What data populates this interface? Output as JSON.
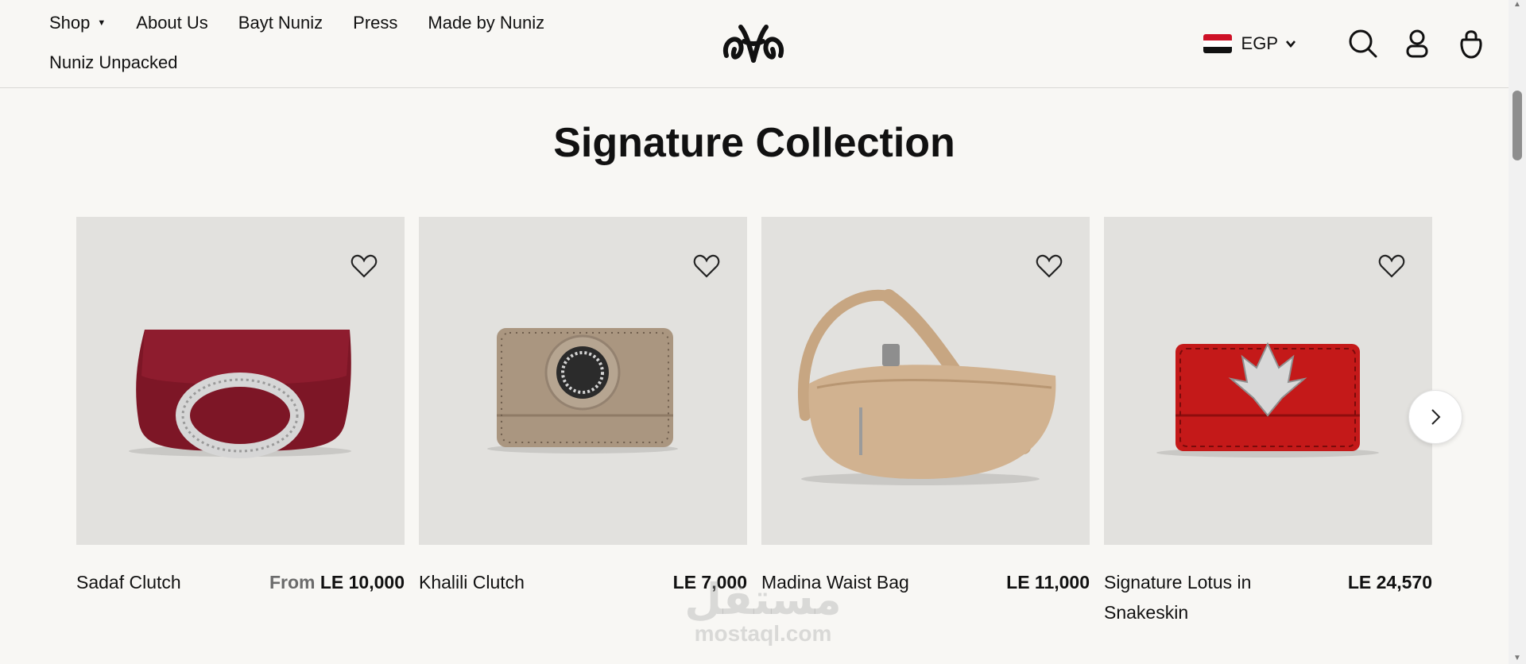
{
  "nav": {
    "items": [
      {
        "label": "Shop",
        "caret": "▼"
      },
      {
        "label": "About Us"
      },
      {
        "label": "Bayt Nuniz"
      },
      {
        "label": "Press"
      },
      {
        "label": "Made by Nuniz"
      },
      {
        "label": "Nuniz Unpacked"
      }
    ]
  },
  "header": {
    "currency": "EGP",
    "flag_colors": [
      "#ce1126",
      "#ffffff",
      "#000000"
    ],
    "icons": [
      "logo-icon",
      "search-icon",
      "account-icon",
      "bag-icon"
    ]
  },
  "collection": {
    "title": "Signature Collection",
    "products": [
      {
        "name": "Sadaf Clutch",
        "price_prefix": "From",
        "price": "LE 10,000",
        "color": "#7d1626"
      },
      {
        "name": "Khalili Clutch",
        "price_prefix": "",
        "price": "LE 7,000",
        "color": "#aa9680"
      },
      {
        "name": "Madina Waist Bag",
        "price_prefix": "",
        "price": "LE 11,000",
        "color": "#d1b290"
      },
      {
        "name": "Signature Lotus in Snakeskin",
        "price_prefix": "",
        "price": "LE 24,570",
        "color": "#c41919"
      }
    ],
    "next_icon": "chevron-right-icon"
  },
  "watermark": {
    "arabic": "مستقل",
    "latin": "mostaql.com"
  }
}
